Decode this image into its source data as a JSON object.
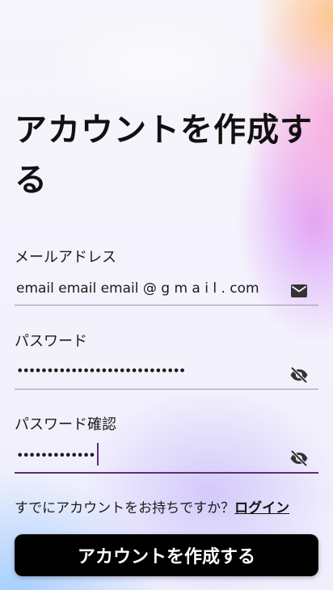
{
  "title": "アカウントを作成する",
  "form": {
    "email": {
      "label": "メールアドレス",
      "value": "email email email @ g m a i l . com",
      "icon": "mail-icon"
    },
    "password": {
      "label": "パスワード",
      "value": "••••••••••••••••••••••••••••",
      "icon": "eye-off-icon"
    },
    "confirm_password": {
      "label": "パスワード確認",
      "value": "•••••••••••••",
      "icon": "eye-off-icon"
    }
  },
  "footer": {
    "prompt": "すでにアカウントをお持ちですか？",
    "login_link": "ログイン"
  },
  "cta": {
    "label": "アカウントを作成する"
  },
  "colors": {
    "button_bg": "#000000",
    "button_text": "#ffffff",
    "focus_underline": "#5b2f78",
    "icon": "#333333"
  }
}
